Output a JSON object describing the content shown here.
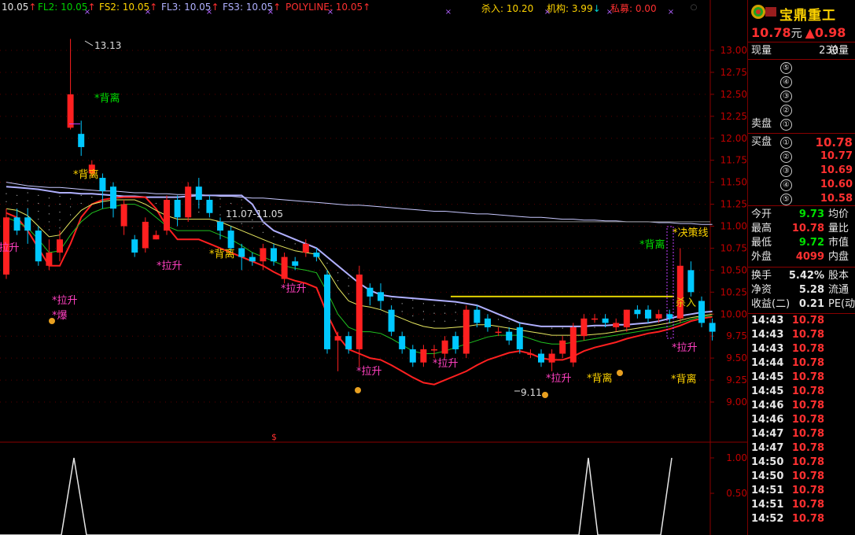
{
  "topbar": {
    "ma_items": [
      {
        "label": "10.05",
        "arrow": "↑",
        "color": "#e6e6e6"
      },
      {
        "label": "FL2: 10.05",
        "arrow": "↑",
        "color": "#00d000"
      },
      {
        "label": "FS2: 10.05",
        "arrow": "↑",
        "color": "#ffd400"
      },
      {
        "label": "FL3: 10.05",
        "arrow": "↑",
        "color": "#b0b0ff"
      },
      {
        "label": "FS3: 10.05",
        "arrow": "↑",
        "color": "#b0b0ff"
      },
      {
        "label": "POLYLINE: 10.05",
        "arrow": "↑",
        "color": "#ff3030"
      }
    ],
    "kill": "杀入: 10.20",
    "inst": "机构: 3.99",
    "inst_arrow": "↓",
    "private": "私募: 0.00"
  },
  "stock": {
    "name": "宝鼎重工",
    "price": "10.78",
    "unit": "元",
    "change": "▲0.98"
  },
  "panel": {
    "xianliang_label": "现量",
    "xianliang_value": "230",
    "zongliang_label": "总量",
    "sell_label": "卖盘",
    "buy_label": "买盘",
    "asks": [
      {
        "n": "⑤",
        "price": ""
      },
      {
        "n": "④",
        "price": ""
      },
      {
        "n": "③",
        "price": ""
      },
      {
        "n": "②",
        "price": ""
      },
      {
        "n": "①",
        "price": ""
      }
    ],
    "bids": [
      {
        "n": "①",
        "price": "10.78"
      },
      {
        "n": "②",
        "price": "10.77"
      },
      {
        "n": "③",
        "price": "10.69"
      },
      {
        "n": "④",
        "price": "10.60"
      },
      {
        "n": "⑤",
        "price": "10.58"
      }
    ],
    "stats": [
      {
        "label": "今开",
        "value": "9.73",
        "color": "#00e000",
        "right": "均价"
      },
      {
        "label": "最高",
        "value": "10.78",
        "color": "#ff3030",
        "right": "量比"
      },
      {
        "label": "最低",
        "value": "9.72",
        "color": "#00e000",
        "right": "市值"
      },
      {
        "label": "外盘",
        "value": "4099",
        "color": "#ff3030",
        "right": "内盘"
      }
    ],
    "stats2": [
      {
        "label": "换手",
        "value": "5.42%",
        "color": "#e6e6e6",
        "right": "股本"
      },
      {
        "label": "净资",
        "value": "5.28",
        "color": "#e6e6e6",
        "right": "流通"
      },
      {
        "label": "收益(二)",
        "value": "0.21",
        "color": "#e6e6e6",
        "right": "PE(动"
      }
    ],
    "ticks": [
      {
        "time": "14:43",
        "price": "10.78"
      },
      {
        "time": "14:43",
        "price": "10.78"
      },
      {
        "time": "14:43",
        "price": "10.78"
      },
      {
        "time": "14:44",
        "price": "10.78"
      },
      {
        "time": "14:45",
        "price": "10.78"
      },
      {
        "time": "14:45",
        "price": "10.78"
      },
      {
        "time": "14:46",
        "price": "10.78"
      },
      {
        "time": "14:46",
        "price": "10.78"
      },
      {
        "time": "14:47",
        "price": "10.78"
      },
      {
        "time": "14:47",
        "price": "10.78"
      },
      {
        "time": "14:50",
        "price": "10.78"
      },
      {
        "time": "14:50",
        "price": "10.78"
      },
      {
        "time": "14:51",
        "price": "10.78"
      },
      {
        "time": "14:51",
        "price": "10.78"
      },
      {
        "time": "14:52",
        "price": "10.78"
      }
    ]
  },
  "chart_data": {
    "type": "candlestick",
    "y_ticks": [
      "13.00",
      "12.75",
      "12.50",
      "12.25",
      "12.00",
      "11.75",
      "11.50",
      "11.25",
      "11.00",
      "10.75",
      "10.50",
      "10.25",
      "10.00",
      "9.75",
      "9.50",
      "9.25",
      "9.00"
    ],
    "ylim": [
      8.75,
      13.2
    ],
    "candles": [
      [
        10.45,
        11.1,
        10.4,
        11.2
      ],
      [
        11.1,
        10.95,
        10.9,
        11.2
      ],
      [
        11.1,
        10.95,
        10.8,
        11.2
      ],
      [
        10.95,
        10.6,
        10.55,
        11.0
      ],
      [
        10.55,
        10.7,
        10.5,
        10.85
      ],
      [
        10.7,
        10.85,
        10.6,
        10.95
      ],
      [
        12.12,
        12.5,
        12.1,
        13.13
      ],
      [
        12.05,
        11.9,
        11.8,
        12.2
      ],
      [
        11.6,
        11.7,
        11.55,
        11.75
      ],
      [
        11.55,
        11.4,
        11.2,
        11.6
      ],
      [
        11.45,
        11.2,
        11.1,
        11.5
      ],
      [
        11.0,
        11.25,
        10.9,
        11.3
      ],
      [
        10.85,
        10.7,
        10.65,
        10.9
      ],
      [
        10.75,
        11.05,
        10.7,
        11.1
      ],
      [
        10.85,
        10.9,
        10.85,
        10.95
      ],
      [
        10.95,
        11.3,
        10.9,
        11.35
      ],
      [
        11.3,
        11.1,
        11.0,
        11.35
      ],
      [
        11.1,
        11.45,
        11.05,
        11.5
      ],
      [
        11.45,
        11.3,
        11.2,
        11.55
      ],
      [
        11.3,
        11.15,
        11.1,
        11.35
      ],
      [
        11.05,
        10.95,
        10.85,
        11.1
      ],
      [
        10.95,
        10.75,
        10.7,
        11.0
      ],
      [
        10.75,
        10.65,
        10.5,
        10.8
      ],
      [
        10.65,
        10.6,
        10.55,
        10.7
      ],
      [
        10.6,
        10.75,
        10.5,
        10.8
      ],
      [
        10.75,
        10.6,
        10.55,
        10.8
      ],
      [
        10.4,
        10.65,
        10.35,
        10.7
      ],
      [
        10.6,
        10.55,
        10.5,
        10.65
      ],
      [
        10.7,
        10.8,
        10.65,
        10.85
      ],
      [
        10.7,
        10.65,
        10.6,
        10.75
      ],
      [
        10.45,
        9.6,
        9.55,
        10.5
      ],
      [
        9.7,
        9.75,
        9.35,
        9.8
      ],
      [
        9.75,
        9.6,
        9.55,
        9.8
      ],
      [
        9.6,
        10.45,
        9.4,
        10.55
      ],
      [
        10.3,
        10.2,
        10.1,
        10.35
      ],
      [
        10.25,
        10.15,
        10.05,
        10.35
      ],
      [
        10.05,
        9.8,
        9.75,
        10.1
      ],
      [
        9.75,
        9.6,
        9.55,
        9.8
      ],
      [
        9.6,
        9.45,
        9.4,
        9.65
      ],
      [
        9.45,
        9.6,
        9.4,
        9.65
      ],
      [
        9.6,
        9.6,
        9.5,
        9.65
      ],
      [
        9.55,
        9.7,
        9.5,
        9.75
      ],
      [
        9.75,
        9.6,
        9.55,
        9.8
      ],
      [
        9.55,
        10.05,
        9.5,
        10.1
      ],
      [
        10.05,
        9.9,
        9.85,
        10.1
      ],
      [
        9.95,
        9.85,
        9.8,
        10.0
      ],
      [
        9.8,
        9.8,
        9.75,
        9.85
      ],
      [
        9.8,
        9.7,
        9.65,
        9.85
      ],
      [
        9.85,
        9.6,
        9.55,
        9.9
      ],
      [
        9.55,
        9.55,
        9.5,
        9.6
      ],
      [
        9.55,
        9.45,
        9.4,
        9.6
      ],
      [
        9.45,
        9.55,
        9.35,
        9.6
      ],
      [
        9.55,
        9.7,
        9.5,
        9.75
      ],
      [
        9.45,
        9.85,
        9.4,
        9.9
      ],
      [
        9.75,
        9.95,
        9.7,
        10.0
      ],
      [
        9.95,
        9.95,
        9.9,
        10.0
      ],
      [
        9.95,
        9.9,
        9.85,
        10.0
      ],
      [
        9.85,
        9.9,
        9.8,
        9.95
      ],
      [
        9.85,
        10.05,
        9.8,
        10.05
      ],
      [
        10.05,
        10.0,
        9.95,
        10.1
      ],
      [
        10.05,
        9.95,
        9.9,
        10.1
      ],
      [
        9.95,
        10.0,
        9.9,
        10.05
      ],
      [
        10.0,
        9.95,
        9.9,
        10.05
      ],
      [
        9.95,
        10.55,
        9.9,
        10.75
      ],
      [
        10.5,
        10.25,
        10.2,
        10.6
      ],
      [
        10.15,
        9.9,
        9.85,
        10.2
      ],
      [
        9.9,
        9.8,
        9.7,
        9.95
      ]
    ],
    "ma_lines": [
      {
        "name": "L1",
        "color": "#c8c8ff",
        "values": [
          11.5,
          11.48,
          11.46,
          11.45,
          11.44,
          11.44,
          11.43,
          11.42,
          11.41,
          11.4,
          11.4,
          11.39,
          11.38,
          11.38,
          11.37,
          11.37,
          11.36,
          11.36,
          11.36,
          11.35,
          11.34,
          11.34,
          11.33,
          11.32,
          11.32,
          11.31,
          11.3,
          11.29,
          11.28,
          11.27,
          11.26,
          11.25,
          11.24,
          11.24,
          11.23,
          11.22,
          11.21,
          11.2,
          11.19,
          11.18,
          11.17,
          11.17,
          11.16,
          11.15,
          11.14,
          11.14,
          11.13,
          11.12,
          11.11,
          11.1,
          11.1,
          11.09,
          11.08,
          11.08,
          11.07,
          11.07,
          11.06,
          11.06,
          11.05,
          11.05,
          11.05,
          11.04,
          11.04,
          11.03,
          11.03,
          11.02,
          11.02
        ]
      },
      {
        "name": "L2",
        "color": "#b0b0ff",
        "values": [
          11.45,
          11.44,
          11.43,
          11.42,
          11.4,
          11.38,
          11.38,
          11.37,
          11.37,
          11.36,
          11.35,
          11.34,
          11.34,
          11.33,
          11.33,
          11.33,
          11.33,
          11.34,
          11.35,
          11.35,
          11.35,
          11.35,
          11.35,
          11.25,
          11.05,
          10.95,
          10.9,
          10.85,
          10.8,
          10.75,
          10.65,
          10.55,
          10.45,
          10.35,
          10.27,
          10.22,
          10.2,
          10.19,
          10.18,
          10.17,
          10.16,
          10.15,
          10.14,
          10.12,
          10.1,
          10.05,
          10.0,
          9.95,
          9.9,
          9.88,
          9.86,
          9.86,
          9.86,
          9.86,
          9.86,
          9.87,
          9.87,
          9.88,
          9.88,
          9.89,
          9.9,
          9.92,
          9.95,
          9.98,
          10.0,
          10.02,
          10.03
        ]
      },
      {
        "name": "L3",
        "color": "#ff2020",
        "values": [
          11.15,
          11.1,
          10.95,
          10.75,
          10.55,
          10.55,
          10.8,
          11.1,
          11.25,
          11.3,
          11.32,
          11.33,
          11.33,
          11.33,
          11.2,
          11.0,
          10.85,
          10.85,
          10.85,
          10.8,
          10.75,
          10.7,
          10.65,
          10.6,
          10.55,
          10.48,
          10.42,
          10.38,
          10.35,
          10.3,
          10.0,
          9.75,
          9.6,
          9.55,
          9.5,
          9.48,
          9.42,
          9.35,
          9.28,
          9.22,
          9.2,
          9.25,
          9.3,
          9.35,
          9.42,
          9.48,
          9.52,
          9.56,
          9.58,
          9.55,
          9.5,
          9.48,
          9.48,
          9.52,
          9.58,
          9.62,
          9.65,
          9.68,
          9.72,
          9.75,
          9.78,
          9.8,
          9.83,
          9.87,
          9.92,
          9.95,
          9.97
        ]
      },
      {
        "name": "L4",
        "color": "#20c020",
        "values": [
          11.1,
          11.05,
          10.98,
          10.85,
          10.7,
          10.72,
          10.9,
          11.05,
          11.15,
          11.2,
          11.22,
          11.25,
          11.25,
          11.2,
          11.1,
          11.0,
          10.95,
          10.95,
          10.95,
          10.95,
          10.9,
          10.85,
          10.78,
          10.7,
          10.65,
          10.6,
          10.55,
          10.52,
          10.5,
          10.47,
          10.25,
          10.0,
          9.85,
          9.8,
          9.8,
          9.78,
          9.72,
          9.65,
          9.58,
          9.55,
          9.55,
          9.58,
          9.62,
          9.66,
          9.7,
          9.74,
          9.76,
          9.76,
          9.76,
          9.72,
          9.68,
          9.66,
          9.66,
          9.68,
          9.7,
          9.72,
          9.74,
          9.76,
          9.78,
          9.8,
          9.82,
          9.84,
          9.86,
          9.9,
          9.94,
          9.97,
          9.98
        ]
      },
      {
        "name": "L5",
        "color": "#e8e860",
        "values": [
          11.2,
          11.18,
          11.12,
          11.0,
          10.88,
          10.9,
          11.05,
          11.18,
          11.25,
          11.28,
          11.3,
          11.3,
          11.3,
          11.25,
          11.18,
          11.12,
          11.08,
          11.08,
          11.08,
          11.08,
          11.05,
          11.0,
          10.95,
          10.9,
          10.85,
          10.8,
          10.76,
          10.72,
          10.7,
          10.68,
          10.5,
          10.3,
          10.15,
          10.1,
          10.08,
          10.05,
          10.0,
          9.95,
          9.9,
          9.86,
          9.84,
          9.84,
          9.85,
          9.86,
          9.88,
          9.88,
          9.86,
          9.84,
          9.82,
          9.8,
          9.78,
          9.76,
          9.76,
          9.76,
          9.76,
          9.77,
          9.78,
          9.8,
          9.82,
          9.84,
          9.86,
          9.88,
          9.9,
          9.93,
          9.96,
          9.98,
          10.0
        ]
      }
    ],
    "hline_kill": 10.2,
    "hline_gray": 11.05,
    "sub_ylim": [
      0,
      1
    ],
    "sub_ticks": [
      "1.00",
      "0.50"
    ]
  },
  "annotations": {
    "high_label": "13.13",
    "low_label": "9.11",
    "range_label": "11.07-11.05",
    "kill_label": "杀入",
    "decision_label": "*决策线",
    "beili": "*背离",
    "lasheng": "*拉升",
    "bao": "*爆",
    "dollar": "$"
  }
}
